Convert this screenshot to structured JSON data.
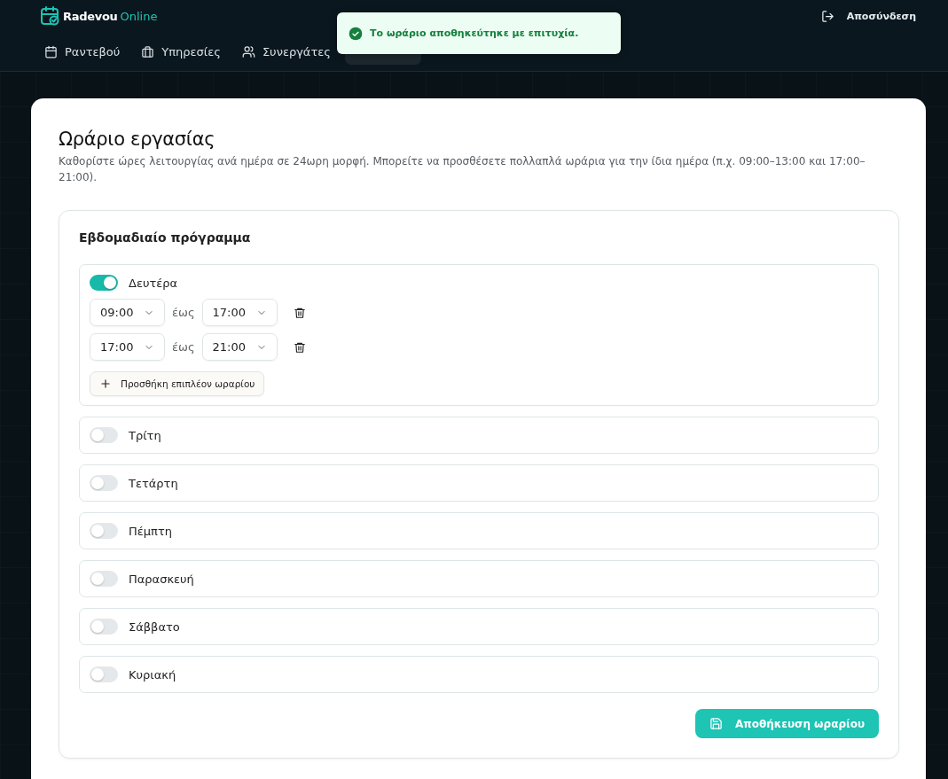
{
  "header": {
    "brand": {
      "name": "Radevou",
      "suffix": "Online"
    },
    "nav": [
      {
        "label": "Ραντεβού",
        "selected": false
      },
      {
        "label": "Υπηρεσίες",
        "selected": false
      },
      {
        "label": "Συνεργάτες",
        "selected": false
      },
      {
        "selected": true
      }
    ],
    "logout": "Αποσύνδεση"
  },
  "toast": {
    "kind": "success",
    "message": "Το ωράριο αποθηκεύτηκε με επιτυχία."
  },
  "page": {
    "title": "Ωράριο εργασίας",
    "description": "Καθορίστε ώρες λειτουργίας ανά ημέρα σε 24ωρη μορφή. Μπορείτε να προσθέσετε πολλαπλά ωράρια για την ίδια ημέρα (π.χ. 09:00–13:00 και 17:00–21:00)."
  },
  "schedule": {
    "title": "Εβδομαδιαίο πρόγραμμα",
    "days": [
      {
        "name": "Δευτέρα",
        "on": true,
        "slots": [
          {
            "from": "09:00",
            "separator": "έως",
            "to": "17:00"
          },
          {
            "from": "17:00",
            "separator": "έως",
            "to": "21:00"
          }
        ],
        "add_label": "Προσθήκη επιπλέον ωραρίου"
      },
      {
        "name": "Τρίτη",
        "on": false
      },
      {
        "name": "Τετάρτη",
        "on": false
      },
      {
        "name": "Πέμπτη",
        "on": false
      },
      {
        "name": "Παρασκευή",
        "on": false
      },
      {
        "name": "Σάββατο",
        "on": false
      },
      {
        "name": "Κυριακή",
        "on": false
      }
    ],
    "save_label": "Αποθήκευση ωραρίου"
  }
}
